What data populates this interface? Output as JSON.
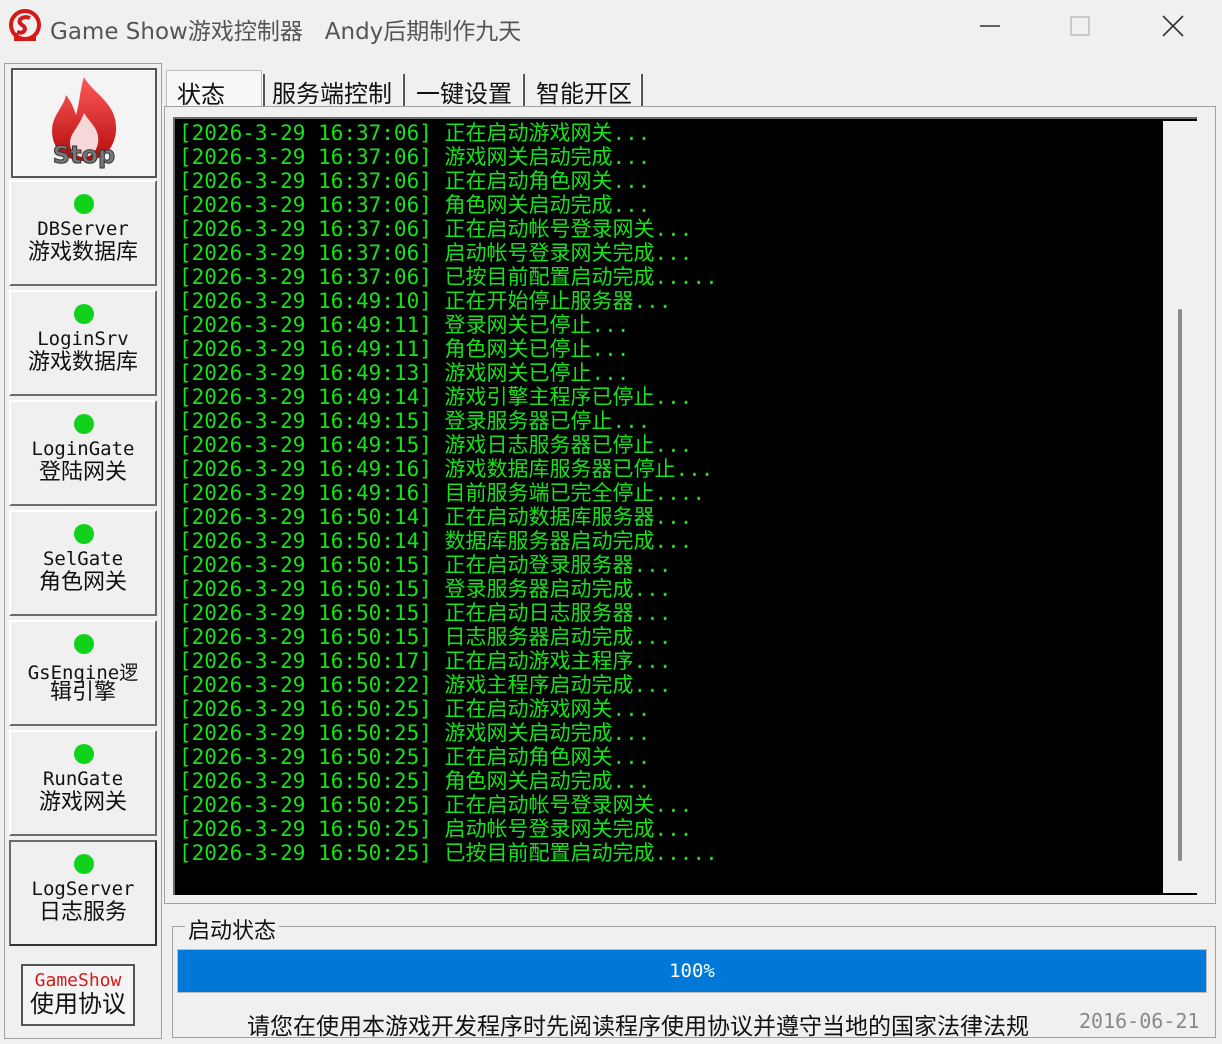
{
  "window": {
    "title": "Game Show游戏控制器   Andy后期制作九天",
    "colors": {
      "accent": "#0078d7",
      "log_text": "#16e21a",
      "log_bg": "#000000",
      "led": "#10d21a",
      "brand_red": "#d51818"
    }
  },
  "sidebar": {
    "stop_label": "Stop",
    "services": [
      {
        "name": "DBServer",
        "desc": "游戏数据库",
        "status": "running"
      },
      {
        "name": "LoginSrv",
        "desc": "游戏数据库",
        "status": "running"
      },
      {
        "name": "LoginGate",
        "desc": "登陆网关",
        "status": "running"
      },
      {
        "name": "SelGate",
        "desc": "角色网关",
        "status": "running"
      },
      {
        "name": "GsEngine逻",
        "desc": "辑引擎",
        "status": "running"
      },
      {
        "name": "RunGate",
        "desc": "游戏网关",
        "status": "running"
      },
      {
        "name": "LogServer",
        "desc": "日志服务",
        "status": "running"
      }
    ],
    "agreement": {
      "brand": "GameShow",
      "label": "使用协议"
    }
  },
  "tabs": [
    {
      "label": "状态",
      "active": true
    },
    {
      "label": "服务端控制",
      "active": false
    },
    {
      "label": "一键设置",
      "active": false
    },
    {
      "label": "智能开区",
      "active": false
    }
  ],
  "log": [
    "[2026-3-29 16:37:06] 正在启动游戏网关...",
    "[2026-3-29 16:37:06] 游戏网关启动完成...",
    "[2026-3-29 16:37:06] 正在启动角色网关...",
    "[2026-3-29 16:37:06] 角色网关启动完成...",
    "[2026-3-29 16:37:06] 正在启动帐号登录网关...",
    "[2026-3-29 16:37:06] 启动帐号登录网关完成...",
    "[2026-3-29 16:37:06] 已按目前配置启动完成.....",
    "[2026-3-29 16:49:10] 正在开始停止服务器...",
    "[2026-3-29 16:49:11] 登录网关已停止...",
    "[2026-3-29 16:49:11] 角色网关已停止...",
    "[2026-3-29 16:49:13] 游戏网关已停止...",
    "[2026-3-29 16:49:14] 游戏引擎主程序已停止...",
    "[2026-3-29 16:49:15] 登录服务器已停止...",
    "[2026-3-29 16:49:15] 游戏日志服务器已停止...",
    "[2026-3-29 16:49:16] 游戏数据库服务器已停止...",
    "[2026-3-29 16:49:16] 目前服务端已完全停止....",
    "[2026-3-29 16:50:14] 正在启动数据库服务器...",
    "[2026-3-29 16:50:14] 数据库服务器启动完成...",
    "[2026-3-29 16:50:15] 正在启动登录服务器...",
    "[2026-3-29 16:50:15] 登录服务器启动完成...",
    "[2026-3-29 16:50:15] 正在启动日志服务器...",
    "[2026-3-29 16:50:15] 日志服务器启动完成...",
    "[2026-3-29 16:50:17] 正在启动游戏主程序...",
    "[2026-3-29 16:50:22] 游戏主程序启动完成...",
    "[2026-3-29 16:50:25] 正在启动游戏网关...",
    "[2026-3-29 16:50:25] 游戏网关启动完成...",
    "[2026-3-29 16:50:25] 正在启动角色网关...",
    "[2026-3-29 16:50:25] 角色网关启动完成...",
    "[2026-3-29 16:50:25] 正在启动帐号登录网关...",
    "[2026-3-29 16:50:25] 启动帐号登录网关完成...",
    "[2026-3-29 16:50:25] 已按目前配置启动完成....."
  ],
  "status": {
    "legend": "启动状态",
    "progress_percent": 100,
    "progress_label": "100%",
    "notice": "请您在使用本游戏开发程序时先阅读程序使用协议并遵守当地的国家法律法规",
    "date": "2016-06-21"
  }
}
